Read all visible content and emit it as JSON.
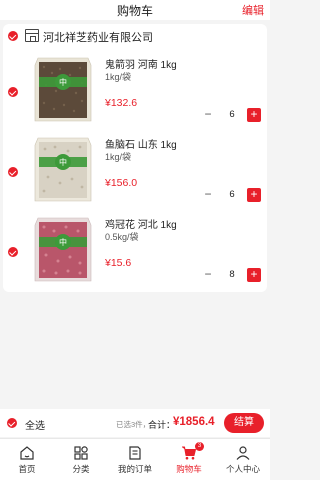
{
  "header": {
    "title": "购物车",
    "edit_label": "编辑"
  },
  "shop": {
    "name": "河北祥芝药业有限公司"
  },
  "items": [
    {
      "name": "鬼箭羽 河南 1kg",
      "spec": "1kg/袋",
      "price": "¥132.6",
      "qty": "6",
      "bag_label": "中药饮片",
      "bag_color": "#5c4a3a"
    },
    {
      "name": "鱼脑石 山东 1kg",
      "spec": "1kg/袋",
      "price": "¥156.0",
      "qty": "6",
      "bag_label": "中药饮片",
      "bag_color": "#d8d2c4"
    },
    {
      "name": "鸡冠花 河北 1kg",
      "spec": "0.5kg/袋",
      "price": "¥15.6",
      "qty": "8",
      "bag_label": "中药饮片",
      "bag_color": "#b9566a"
    }
  ],
  "totals": {
    "select_all_label": "全选",
    "selected_text": "已选3件，",
    "sum_label": "合计：",
    "sum_value": "¥1856.4",
    "settle_label": "结算"
  },
  "tabbar": {
    "tabs": [
      {
        "label": "首页",
        "icon": "home-icon"
      },
      {
        "label": "分类",
        "icon": "category-icon"
      },
      {
        "label": "我的订单",
        "icon": "order-icon"
      },
      {
        "label": "购物车",
        "icon": "cart-icon",
        "active": true,
        "badge": "3"
      },
      {
        "label": "个人中心",
        "icon": "user-icon"
      }
    ]
  },
  "colors": {
    "accent": "#e8202a",
    "bag_green": "#3d9a3a"
  }
}
